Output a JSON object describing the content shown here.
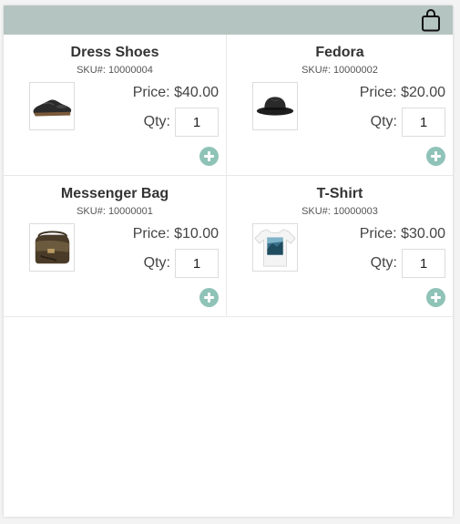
{
  "colors": {
    "header_bar": "#b4c4c0",
    "add_button": "#8fc3b8"
  },
  "header": {
    "cart_icon": "shopping-bag-icon"
  },
  "products": [
    {
      "name": "Dress Shoes",
      "sku": "SKU#: 10000004",
      "price": "Price: $40.00",
      "qty_label": "Qty:",
      "qty": "1",
      "image": "dress-shoe"
    },
    {
      "name": "Fedora",
      "sku": "SKU#: 10000002",
      "price": "Price: $20.00",
      "qty_label": "Qty:",
      "qty": "1",
      "image": "fedora-hat"
    },
    {
      "name": "Messenger Bag",
      "sku": "SKU#: 10000001",
      "price": "Price: $10.00",
      "qty_label": "Qty:",
      "qty": "1",
      "image": "messenger-bag"
    },
    {
      "name": "T-Shirt",
      "sku": "SKU#: 10000003",
      "price": "Price: $30.00",
      "qty_label": "Qty:",
      "qty": "1",
      "image": "t-shirt"
    }
  ]
}
